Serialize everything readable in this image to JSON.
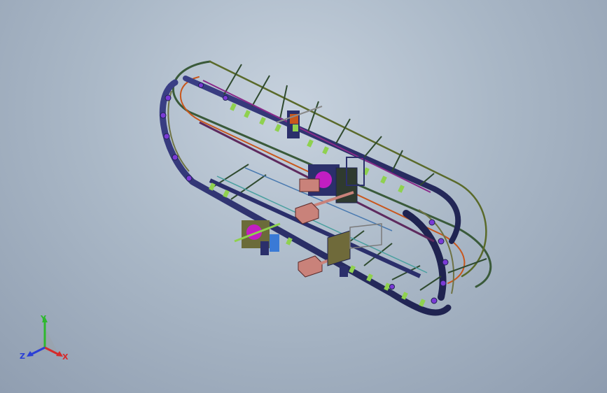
{
  "viewport": {
    "background_center": "#c7d2de",
    "background_edge": "#8e9caf"
  },
  "triad": {
    "x_label": "X",
    "y_label": "Y",
    "z_label": "Z",
    "x_color": "#d62b2b",
    "y_color": "#2eb82e",
    "z_color": "#2a3fd6"
  },
  "model": {
    "frame_color": "#2b2f6b",
    "rail_color": "#3a5a3a",
    "accent_magenta": "#c21ec2",
    "accent_orange": "#c9571d",
    "accent_green": "#8fd14f",
    "block_color": "#c9827a"
  }
}
